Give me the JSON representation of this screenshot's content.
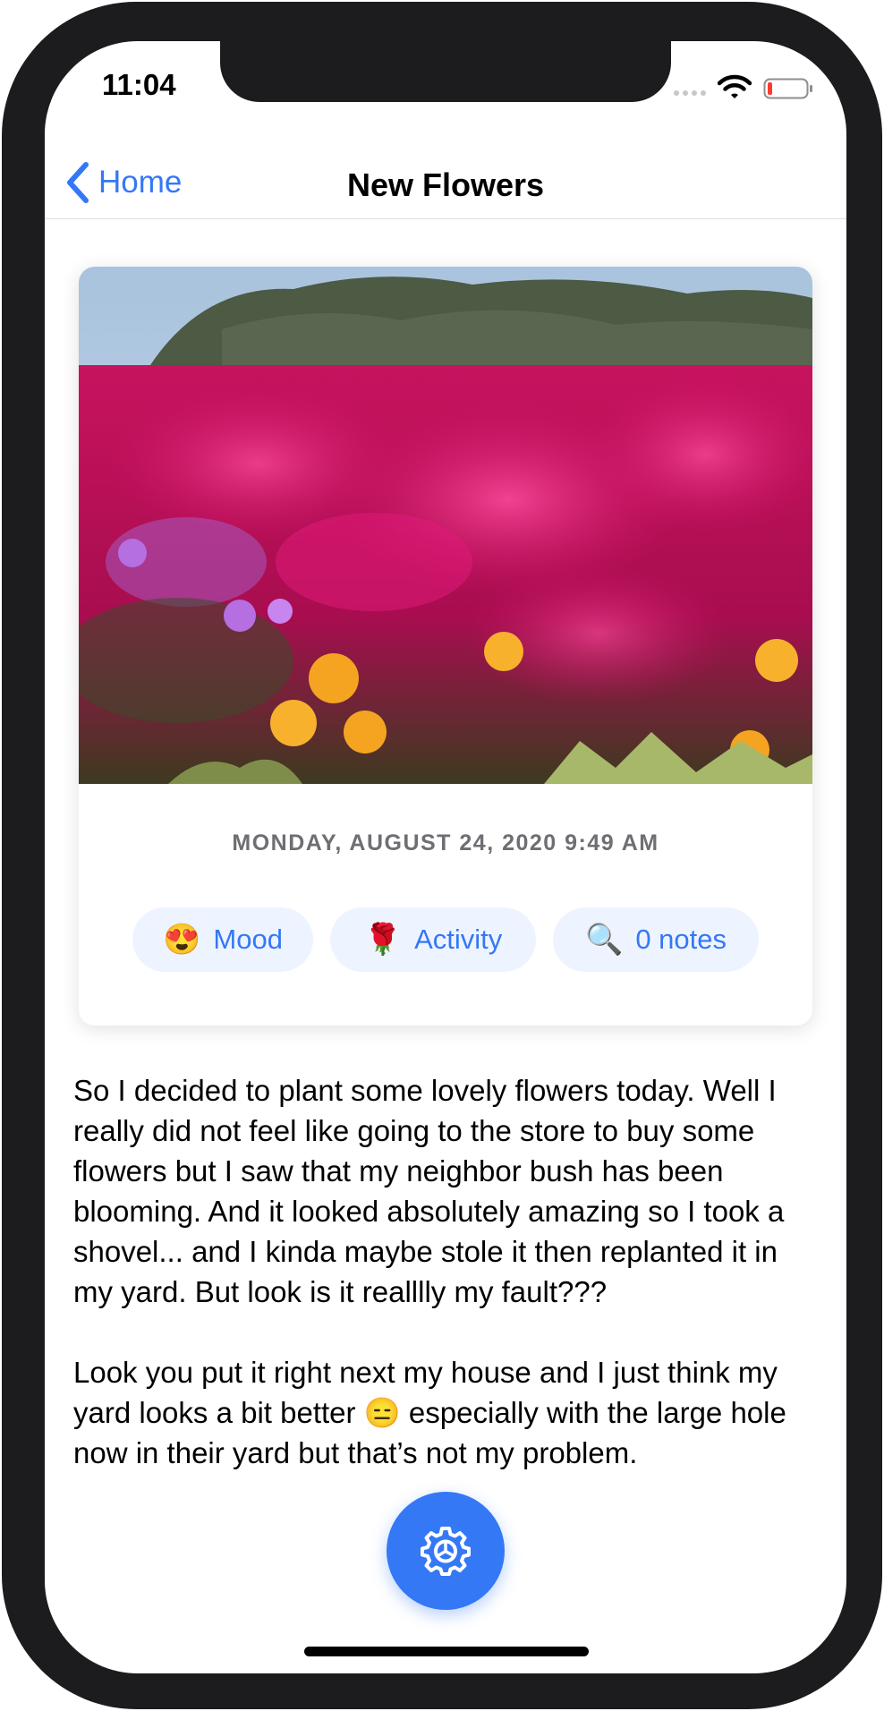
{
  "status_bar": {
    "time": "11:04",
    "icons": [
      "signal-dots-icon",
      "wifi-icon",
      "battery-low-icon"
    ]
  },
  "navbar": {
    "back_label": "Home",
    "title": "New Flowers"
  },
  "entry": {
    "photo": "flower-bed-photo",
    "date": "MONDAY, AUGUST 24, 2020 9:49 AM",
    "chips": [
      {
        "icon": "😍",
        "label": "Mood"
      },
      {
        "icon": "🌹",
        "label": "Activity"
      },
      {
        "icon": "🔍",
        "label": "0 notes"
      }
    ],
    "paragraphs": [
      "So I decided to plant some lovely flowers today. Well I really did not feel like going to the store to buy some flowers but I saw that my neighbor bush has been blooming. And it looked absolutely amazing so I took a shovel... and I kinda maybe stole it then replanted it in my yard. But look is it realllly my fault???",
      "Look you put it right next my house and I just think my yard looks a bit better 😑 especially with the large hole now in their yard but that’s not my problem."
    ]
  },
  "fab": {
    "icon": "gear-icon"
  },
  "colors": {
    "accent": "#3478f6",
    "chip_background": "#eef4ff",
    "date_text": "#6e6e73",
    "bezel": "#1c1c1e"
  }
}
